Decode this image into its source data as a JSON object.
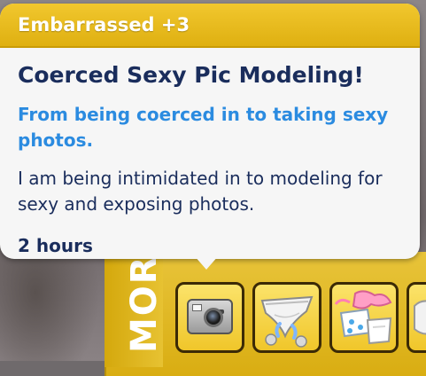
{
  "tooltip": {
    "emotion": "Embarrassed +3",
    "title": "Coerced Sexy Pic Modeling!",
    "reason": "From being coerced in to taking sexy photos.",
    "description": "I am being intimidated in to modeling for sexy and exposing photos.",
    "duration": "2 hours"
  },
  "mood_panel": {
    "label": "MORT",
    "moodlets": [
      {
        "icon": "camera-icon"
      },
      {
        "icon": "underwear-icon"
      },
      {
        "icon": "clothing-pile-icon"
      },
      {
        "icon": "partial-moodlet-icon"
      }
    ]
  },
  "colors": {
    "header_yellow": "#f1c72e",
    "title_navy": "#1a2d5c",
    "reason_blue": "#2b8be0",
    "tooltip_bg": "#f6f6f6"
  }
}
